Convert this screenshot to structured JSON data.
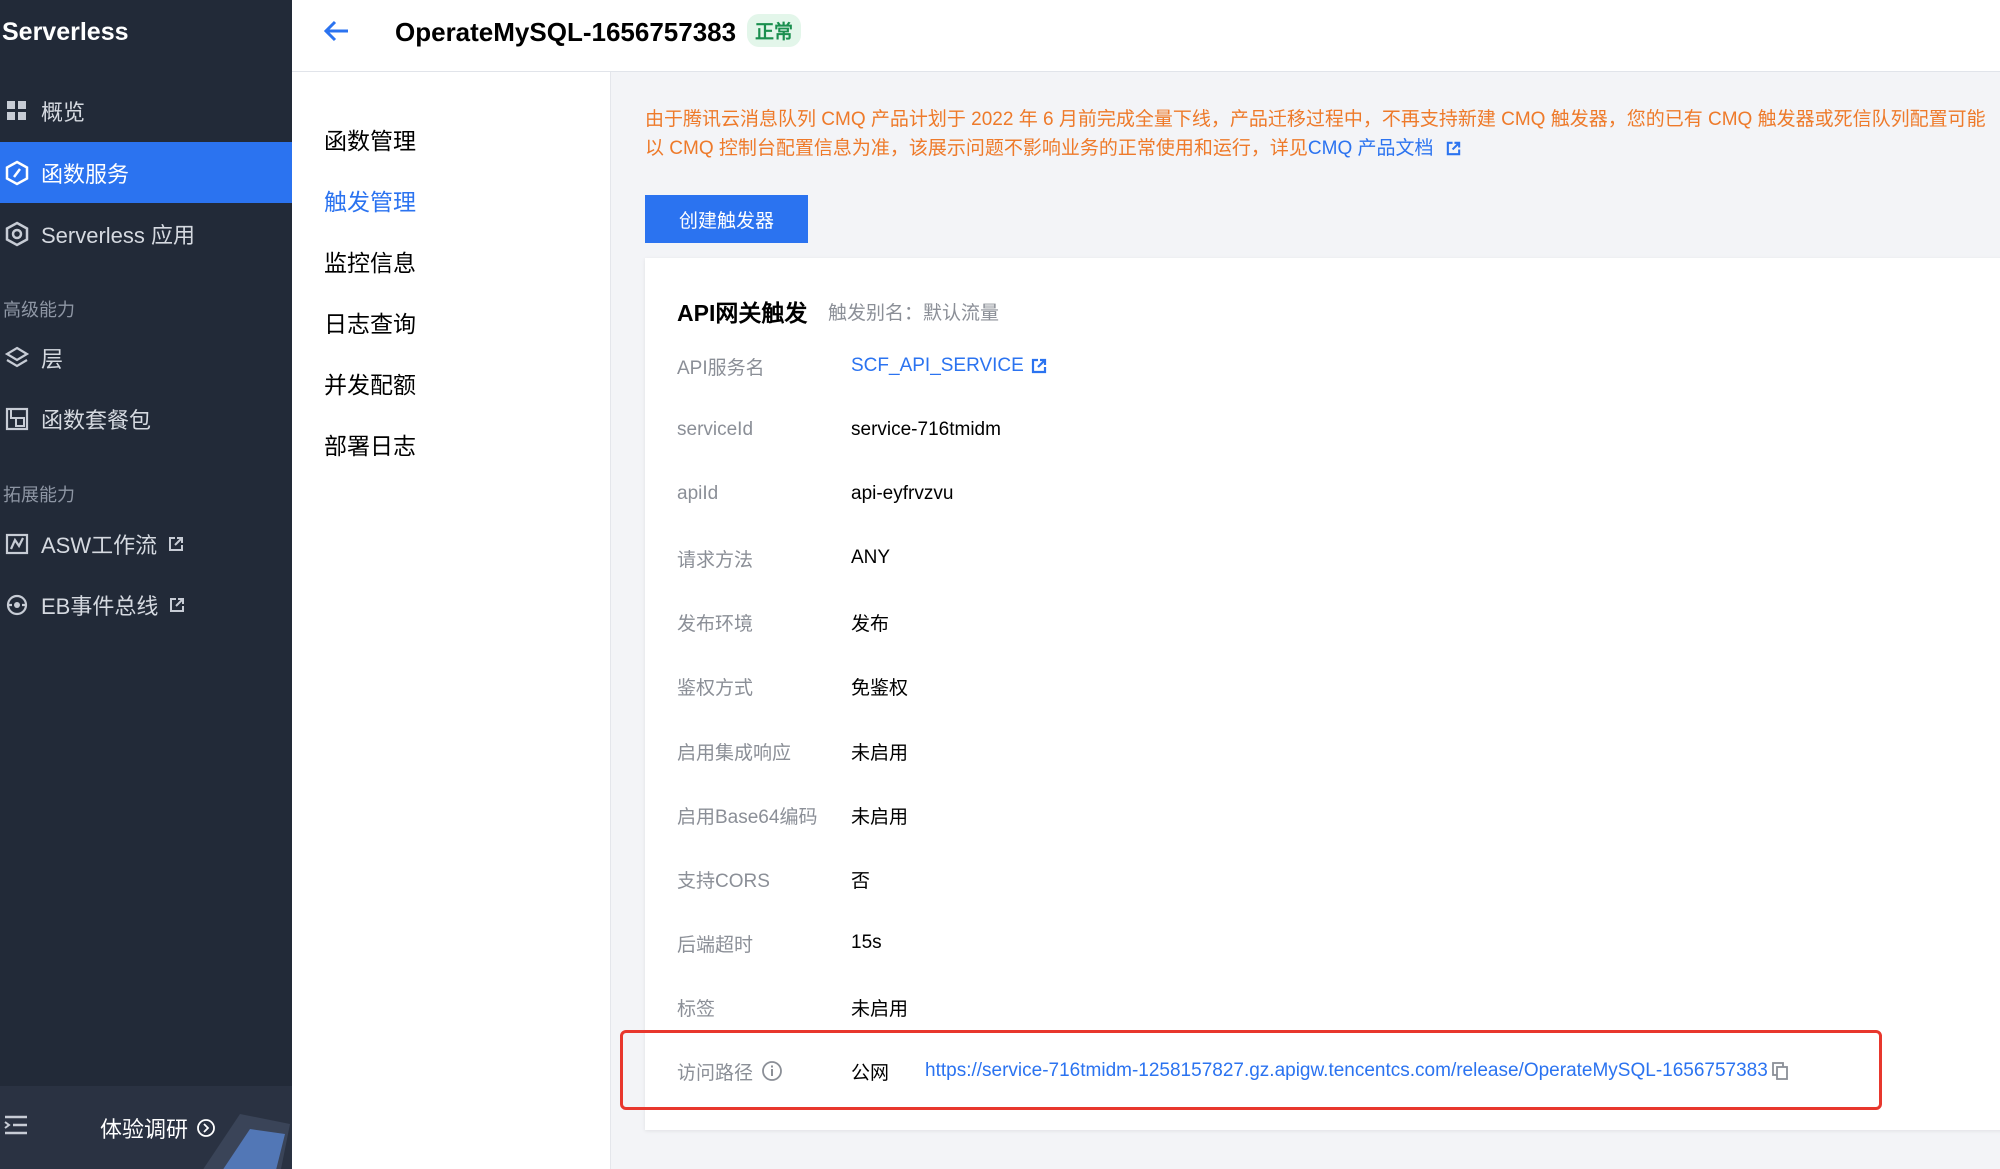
{
  "sidebar": {
    "logo": "Serverless",
    "items": [
      {
        "label": "概览",
        "icon": "dashboard-icon"
      },
      {
        "label": "函数服务",
        "icon": "function-icon"
      },
      {
        "label": "Serverless 应用",
        "icon": "app-icon"
      },
      {
        "label": "层",
        "icon": "layers-icon"
      },
      {
        "label": "函数套餐包",
        "icon": "package-icon"
      },
      {
        "label": "ASW工作流",
        "icon": "workflow-icon"
      },
      {
        "label": "EB事件总线",
        "icon": "eventbus-icon"
      }
    ],
    "sections": [
      "高级能力",
      "拓展能力"
    ],
    "survey": "体验调研"
  },
  "header": {
    "title": "OperateMySQL-1656757383",
    "status": "正常"
  },
  "subnav": [
    "函数管理",
    "触发管理",
    "监控信息",
    "日志查询",
    "并发配额",
    "部署日志"
  ],
  "notice": {
    "line1": "由于腾讯云消息队列 CMQ 产品计划于 2022 年 6 月前完成全量下线，产品迁移过程中，不再支持新建 CMQ 触发器，您的已有 CMQ 触发器或死信队列配置可能",
    "line2": "以 CMQ 控制台配置信息为准，该展示问题不影响业务的正常使用和运行，详见",
    "link": "CMQ 产品文档"
  },
  "create_button": "创建触发器",
  "trigger": {
    "title": "API网关触发",
    "alias": "触发别名：默认流量",
    "rows": [
      {
        "label": "API服务名",
        "value": "SCF_API_SERVICE"
      },
      {
        "label": "serviceId",
        "value": "service-716tmidm"
      },
      {
        "label": "apiId",
        "value": "api-eyfrvzvu"
      },
      {
        "label": "请求方法",
        "value": "ANY"
      },
      {
        "label": "发布环境",
        "value": "发布"
      },
      {
        "label": "鉴权方式",
        "value": "免鉴权"
      },
      {
        "label": "启用集成响应",
        "value": "未启用"
      },
      {
        "label": "启用Base64编码",
        "value": "未启用"
      },
      {
        "label": "支持CORS",
        "value": "否"
      },
      {
        "label": "后端超时",
        "value": "15s"
      },
      {
        "label": "标签",
        "value": "未启用"
      }
    ],
    "access": {
      "label": "访问路径",
      "network": "公网",
      "url": "https://service-716tmidm-1258157827.gz.apigw.tencentcs.com/release/OperateMySQL-1656757383"
    }
  },
  "colors": {
    "sidebar_bg": "#222a38",
    "accent": "#2b73f0",
    "warning_text": "#ee7a2a",
    "status_green": "#1b8f4f",
    "highlight_red": "#e8372d"
  }
}
